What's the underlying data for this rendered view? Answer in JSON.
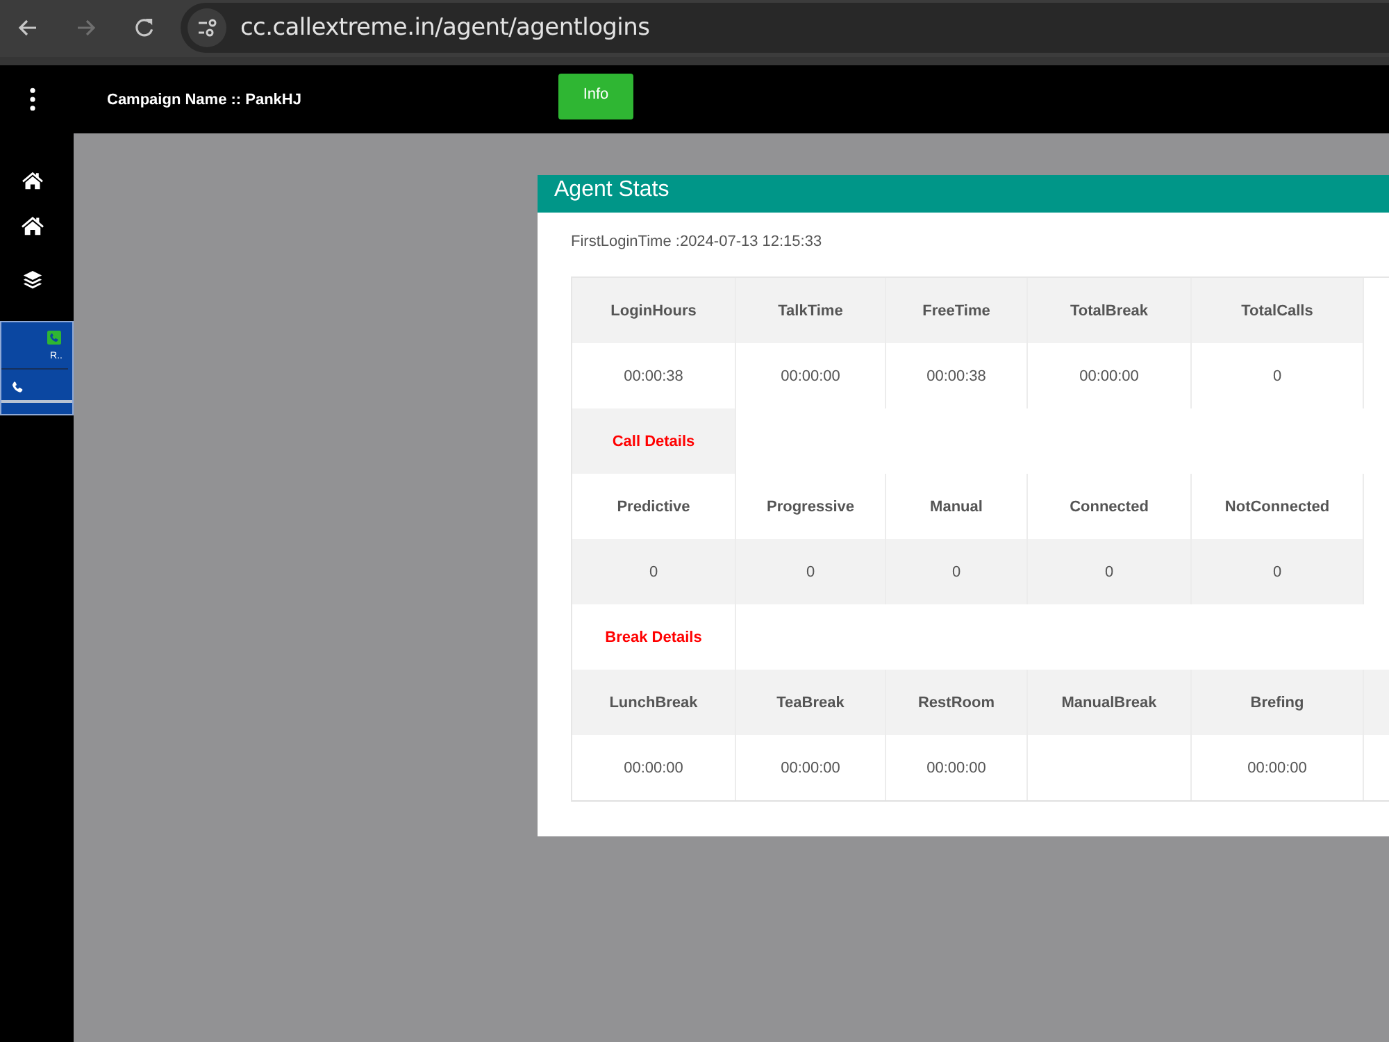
{
  "browser": {
    "url": "cc.callextreme.in/agent/agentlogins"
  },
  "header": {
    "campaign": "Campaign Name :: PankHJ",
    "info_button": "Info"
  },
  "call_panel": {
    "status": "R.."
  },
  "agent_stats": {
    "title": "Agent Stats",
    "first_login": "FirstLoginTime :2024-07-13 12:15:33",
    "sections": [
      {
        "stats": [
          {
            "label": "LoginHours",
            "value": "00:00:38"
          },
          {
            "label": "TalkTime",
            "value": "00:00:00"
          },
          {
            "label": "FreeTime",
            "value": "00:00:38"
          },
          {
            "label": "TotalBreak",
            "value": "00:00:00"
          },
          {
            "label": "TotalCalls",
            "value": "0"
          }
        ]
      },
      {
        "label": "Call Details",
        "stats": [
          {
            "label": "Predictive",
            "value": "0"
          },
          {
            "label": "Progressive",
            "value": "0"
          },
          {
            "label": "Manual",
            "value": "0"
          },
          {
            "label": "Connected",
            "value": "0"
          },
          {
            "label": "NotConnected",
            "value": "0"
          }
        ]
      },
      {
        "label": "Break Details",
        "stats": [
          {
            "label": "LunchBreak",
            "value": "00:00:00"
          },
          {
            "label": "TeaBreak",
            "value": "00:00:00"
          },
          {
            "label": "RestRoom",
            "value": "00:00:00"
          },
          {
            "label": "ManualBreak"
          },
          {
            "label": "Brefing",
            "value": "00:00:00"
          }
        ]
      }
    ]
  }
}
